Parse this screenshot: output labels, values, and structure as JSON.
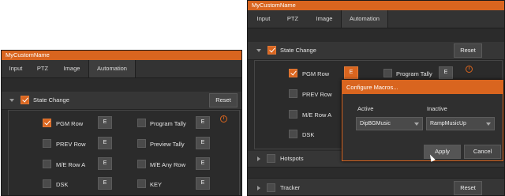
{
  "left": {
    "title": "MyCustomName",
    "tabs": [
      "Input",
      "PTZ",
      "Image",
      "Automation"
    ],
    "section_title": "State Change",
    "reset": "Reset",
    "e": "E",
    "col1": [
      "PGM Row",
      "PREV Row",
      "M/E Row A",
      "DSK"
    ],
    "col2": [
      "Program Tally",
      "Preview Tally",
      "M/E Any Row",
      "KEY"
    ],
    "info": "i"
  },
  "right": {
    "title": "MyCustomName",
    "tabs": [
      "Input",
      "PTZ",
      "Image",
      "Automation"
    ],
    "section_title": "State Change",
    "reset": "Reset",
    "e": "E",
    "col1": [
      "PGM Row",
      "PREV Row",
      "M/E Row A",
      "DSK"
    ],
    "col2": [
      "Program Tally"
    ],
    "info": "i",
    "hotspots": "Hotspots",
    "tracker": "Tracker",
    "tracker_reset": "Reset"
  },
  "dialog": {
    "title": "Configure Macros...",
    "active_label": "Active",
    "inactive_label": "Inactive",
    "active_value": "DipBGMusic",
    "inactive_value": "RampMusicUp",
    "apply": "Apply",
    "cancel": "Cancel"
  },
  "colors": {
    "accent": "#d9651f",
    "panel": "#2b2b2b"
  }
}
